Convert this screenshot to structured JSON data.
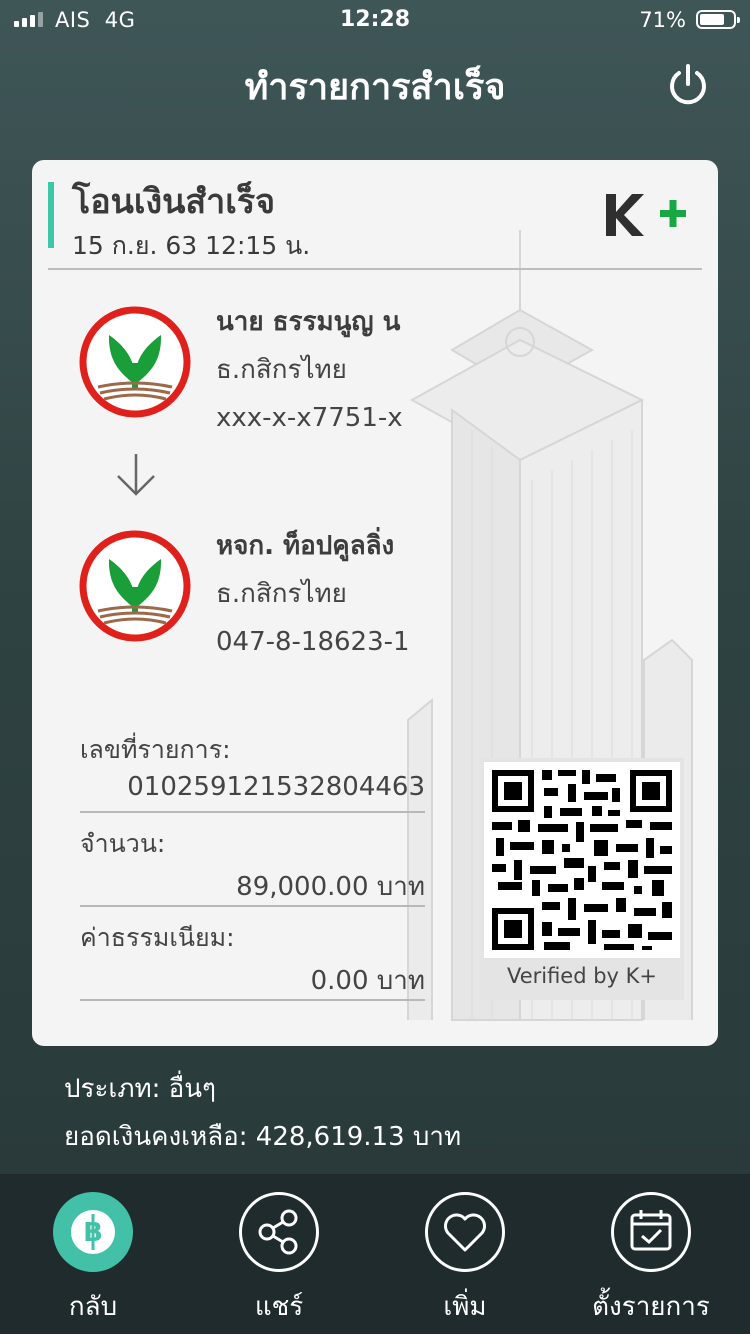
{
  "status_bar": {
    "carrier": "AIS",
    "network": "4G",
    "time": "12:28",
    "battery_percent": "71%"
  },
  "header": {
    "title": "ทำรายการสำเร็จ",
    "power_icon": "power-icon"
  },
  "receipt": {
    "title": "โอนเงินสำเร็จ",
    "datetime": "15 ก.ย. 63  12:15 น.",
    "brand_logo": "K+",
    "sender": {
      "name": "นาย ธรรมนูญ น",
      "bank": "ธ.กสิกรไทย",
      "account": "xxx-x-x7751-x"
    },
    "receiver": {
      "name": "หจก. ท็อปคูลลิ่ง",
      "bank": "ธ.กสิกรไทย",
      "account": "047-8-18623-1"
    },
    "reference_label": "เลขที่รายการ:",
    "reference_value": "010259121532804463",
    "amount_label": "จำนวน:",
    "amount_value": "89,000.00 บาท",
    "fee_label": "ค่าธรรมเนียม:",
    "fee_value": "0.00 บาท",
    "qr_caption": "Verified by K+"
  },
  "details": {
    "type": "ประเภท: อื่นๆ",
    "balance": "ยอดเงินคงเหลือ: 428,619.13 บาท"
  },
  "tabs": [
    {
      "label": "กลับ",
      "icon": "baht-coin-icon",
      "active": true
    },
    {
      "label": "แชร์",
      "icon": "share-icon",
      "active": false
    },
    {
      "label": "เพิ่ม",
      "icon": "heart-icon",
      "active": false
    },
    {
      "label": "ตั้งรายการ",
      "icon": "calendar-check-icon",
      "active": false
    }
  ],
  "colors": {
    "accent": "#43c1a8",
    "kbank_green": "#1a9e3a",
    "kbank_red": "#e0201b",
    "kplus_green": "#18a843"
  }
}
